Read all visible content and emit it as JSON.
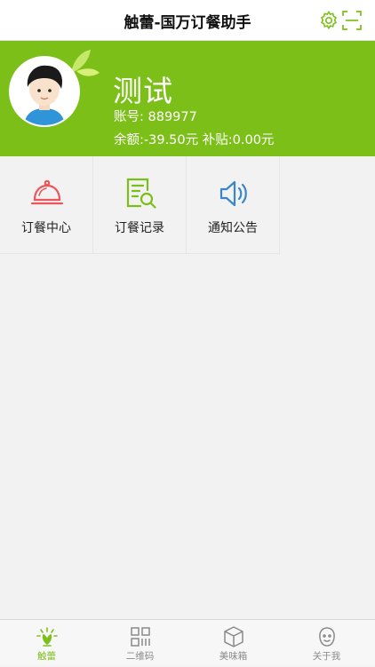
{
  "navbar": {
    "title": "触蕾-国万订餐助手",
    "icons": [
      "gear-icon",
      "scan-icon"
    ]
  },
  "profile": {
    "name": "测试",
    "account_label": "账号:",
    "account_value": "889977",
    "balance_label": "余额:",
    "balance_value": "-39.50元",
    "subsidy_label": "补贴:",
    "subsidy_value": "0.00元"
  },
  "menu": [
    {
      "label": "订餐中心",
      "icon": "cloche-icon",
      "color": "#e8585a"
    },
    {
      "label": "订餐记录",
      "icon": "record-search-icon",
      "color": "#7cbf18"
    },
    {
      "label": "通知公告",
      "icon": "speaker-icon",
      "color": "#3a86c8"
    }
  ],
  "tabbar": [
    {
      "label": "触蕾",
      "icon": "bud-icon",
      "active": true
    },
    {
      "label": "二维码",
      "icon": "qrcode-icon",
      "active": false
    },
    {
      "label": "美味箱",
      "icon": "box-icon",
      "active": false
    },
    {
      "label": "关于我",
      "icon": "face-icon",
      "active": false
    }
  ],
  "colors": {
    "brand": "#7cbf18",
    "background": "#f2f2f2",
    "inactive": "#8a8a8a"
  }
}
